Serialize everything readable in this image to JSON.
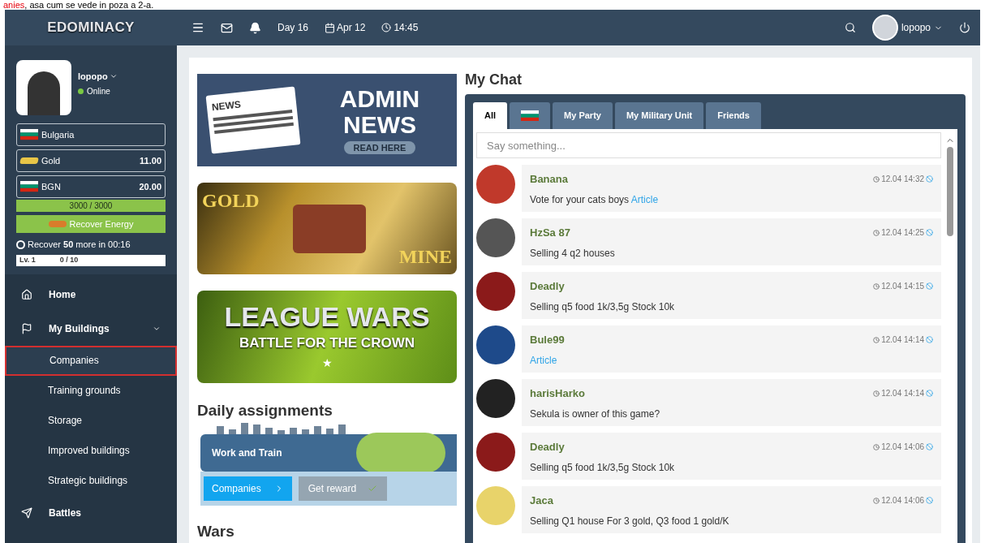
{
  "caption": {
    "highlight": "anies",
    "rest": ", asa cum se vede  in poza a 2-a."
  },
  "topbar": {
    "logo": "EDOMINACY",
    "day": "Day 16",
    "date": "Apr 12",
    "time": "14:45",
    "user": "lopopo"
  },
  "profile": {
    "name": "lopopo",
    "status": "Online",
    "online": true,
    "country": "Bulgaria",
    "gold_label": "Gold",
    "gold": "11.00",
    "currency_label": "BGN",
    "currency": "20.00",
    "energy": "3000 / 3000",
    "recover_button": "Recover Energy",
    "recover_text": "Recover **50** more in 00:16",
    "level_label": "Lv. 1",
    "xp": "0 / 10"
  },
  "nav": [
    {
      "label": "Home",
      "selected": false
    },
    {
      "label": "My Buildings",
      "expanded": true,
      "selected": false,
      "children": [
        {
          "label": "Companies",
          "selected": true
        },
        {
          "label": "Training grounds",
          "selected": false
        },
        {
          "label": "Storage",
          "selected": false
        },
        {
          "label": "Improved buildings",
          "selected": false
        },
        {
          "label": "Strategic buildings",
          "selected": false
        }
      ]
    },
    {
      "label": "Battles",
      "selected": false
    }
  ],
  "banners": {
    "news_title_1": "ADMIN",
    "news_title_2": "NEWS",
    "news_paper": "NEWS",
    "news_button": "READ HERE",
    "gold_1": "GOLD",
    "gold_2": "MINE",
    "league_1": "LEAGUE WARS",
    "league_2": "BATTLE FOR THE CROWN",
    "league_star": "★"
  },
  "daily": {
    "title": "Daily assignments",
    "task": "Work and Train",
    "go_button": "Companies",
    "reward_button": "Get reward"
  },
  "wars_title": "Wars",
  "chat": {
    "title": "My Chat",
    "placeholder": "Say something...",
    "tabs": [
      {
        "label": "All",
        "kind": "text",
        "selected": true
      },
      {
        "kind": "flag",
        "selected": false
      },
      {
        "label": "My Party",
        "kind": "text",
        "selected": false
      },
      {
        "label": "My Military Unit",
        "kind": "text",
        "selected": false
      },
      {
        "label": "Friends",
        "kind": "text",
        "selected": false
      }
    ],
    "messages": [
      {
        "name": "Banana",
        "time": "12.04 14:32",
        "text": "Vote for your cats boys",
        "link": "Article",
        "color": "#c0392b"
      },
      {
        "name": "HzSa 87",
        "time": "12.04 14:25",
        "text": "Selling 4 q2 houses",
        "color": "#555555"
      },
      {
        "name": "Deadly",
        "time": "12.04 14:15",
        "text": "Selling q5 food 1k/3,5g Stock 10k",
        "color": "#8b1a1a"
      },
      {
        "name": "Bule99",
        "time": "12.04 14:14",
        "link": "Article",
        "color": "#1e4a8a"
      },
      {
        "name": "harisHarko",
        "time": "12.04 14:14",
        "text": "Sekula is owner of this game?",
        "color": "#222222"
      },
      {
        "name": "Deadly",
        "time": "12.04 14:06",
        "text": "Selling q5 food 1k/3,5g Stock 10k",
        "color": "#8b1a1a"
      },
      {
        "name": "Jaca",
        "time": "12.04 14:06",
        "text": "Selling Q1 house For 3 gold, Q3 food 1 gold/K",
        "color": "#e8d36a"
      }
    ]
  }
}
